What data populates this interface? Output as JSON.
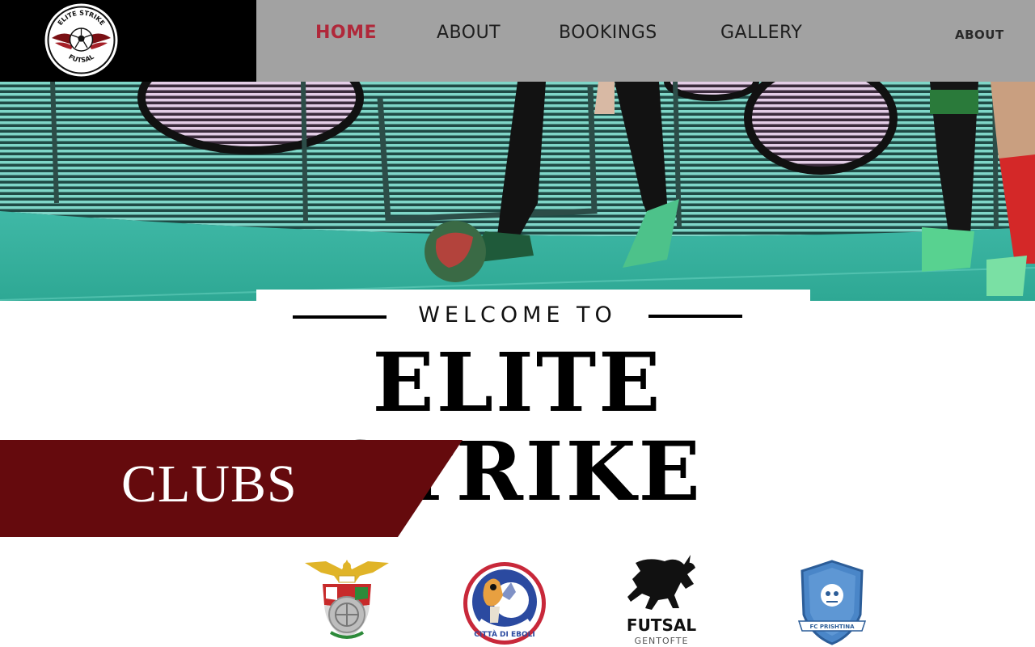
{
  "header": {
    "logo": {
      "icon": "elite-strike-futsal-logo",
      "text_top": "ELITE STRIKE",
      "text_bottom": "FUTSAL"
    },
    "nav": [
      {
        "label": "HOME",
        "active": true
      },
      {
        "label": "ABOUT",
        "active": false
      },
      {
        "label": "BOOKINGS",
        "active": false
      },
      {
        "label": "GALLERY",
        "active": false
      }
    ],
    "secondary_link": "ABOUT"
  },
  "hero": {
    "image": "futsal-players-on-court-photo"
  },
  "welcome": {
    "kicker": "WELCOME TO",
    "title": "ELITE STRIKE"
  },
  "clubs": {
    "heading": "CLUBS",
    "logos": [
      {
        "icon": "benfica-crest-logo"
      },
      {
        "icon": "citta-di-eboli-logo",
        "text": "CITTÀ DI EBOLI"
      },
      {
        "icon": "futsal-gentofte-bull-logo",
        "text_main": "FUTSAL",
        "text_sub": "GENTOFTE"
      },
      {
        "icon": "fc-prishtina-shield-logo",
        "text": "FC PRISHTINA"
      }
    ]
  },
  "colors": {
    "nav_bg": "#a2a2a2",
    "logo_bg": "#000000",
    "active_nav": "#b0283a",
    "banner": "#650a0d"
  }
}
